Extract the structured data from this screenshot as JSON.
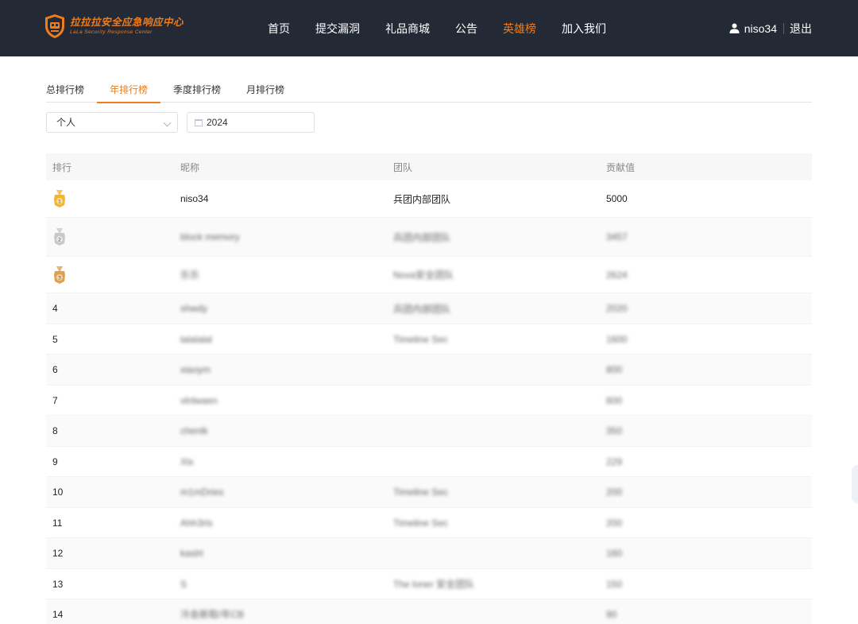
{
  "header": {
    "logo_cn": "拉拉拉安全应急响应中心",
    "logo_en": "LaLa Security Response Center",
    "nav": [
      {
        "label": "首页",
        "active": false
      },
      {
        "label": "提交漏洞",
        "active": false
      },
      {
        "label": "礼品商城",
        "active": false
      },
      {
        "label": "公告",
        "active": false
      },
      {
        "label": "英雄榜",
        "active": true
      },
      {
        "label": "加入我们",
        "active": false
      }
    ],
    "user_icon": "user-icon",
    "username": "niso34",
    "logout": "退出"
  },
  "tabs": [
    {
      "label": "总排行榜",
      "active": false
    },
    {
      "label": "年排行榜",
      "active": true
    },
    {
      "label": "季度排行榜",
      "active": false
    },
    {
      "label": "月排行榜",
      "active": false
    }
  ],
  "filters": {
    "type_value": "个人",
    "year_value": "2024"
  },
  "table": {
    "headers": [
      "排行",
      "昵称",
      "团队",
      "贡献值"
    ],
    "rows": [
      {
        "rank": "",
        "medal": "gold",
        "nickname": "niso34",
        "team": "兵团内部团队",
        "points": "5000",
        "blurred": false
      },
      {
        "rank": "",
        "medal": "silver",
        "nickname": "block memory",
        "team": "兵团内部团队",
        "points": "3457",
        "blurred": true
      },
      {
        "rank": "",
        "medal": "bronze",
        "nickname": "乐乐",
        "team": "Nova安全团队",
        "points": "2624",
        "blurred": true
      },
      {
        "rank": "4",
        "medal": "",
        "nickname": "shwdy",
        "team": "兵团内部团队",
        "points": "2020",
        "blurred": true
      },
      {
        "rank": "5",
        "medal": "",
        "nickname": "lalalalal",
        "team": "Timeline Sec",
        "points": "1600",
        "blurred": true
      },
      {
        "rank": "6",
        "medal": "",
        "nickname": "xiaoym",
        "team": "",
        "points": "800",
        "blurred": true
      },
      {
        "rank": "7",
        "medal": "",
        "nickname": "vlnlwaen",
        "team": "",
        "points": "600",
        "blurred": true
      },
      {
        "rank": "8",
        "medal": "",
        "nickname": "chenlk",
        "team": "",
        "points": "350",
        "blurred": true
      },
      {
        "rank": "9",
        "medal": "",
        "nickname": "Xlx",
        "team": "",
        "points": "229",
        "blurred": true
      },
      {
        "rank": "10",
        "medal": "",
        "nickname": "m1mDries",
        "team": "Timeline Sec",
        "points": "200",
        "blurred": true
      },
      {
        "rank": "11",
        "medal": "",
        "nickname": "Ahh3rls",
        "team": "Timeline Sec",
        "points": "200",
        "blurred": true
      },
      {
        "rank": "12",
        "medal": "",
        "nickname": "kaslrt",
        "team": "",
        "points": "160",
        "blurred": true
      },
      {
        "rank": "13",
        "medal": "",
        "nickname": "S",
        "team": "The loner 安全团队",
        "points": "150",
        "blurred": true
      },
      {
        "rank": "14",
        "medal": "",
        "nickname": "冷会新取/年CB",
        "team": "",
        "points": "90",
        "blurred": true
      }
    ]
  },
  "colors": {
    "accent": "#f07c1a",
    "header_bg": "#242a35",
    "gold": "#f5b52a",
    "silver": "#c9c9c9",
    "bronze": "#e0a14a"
  }
}
